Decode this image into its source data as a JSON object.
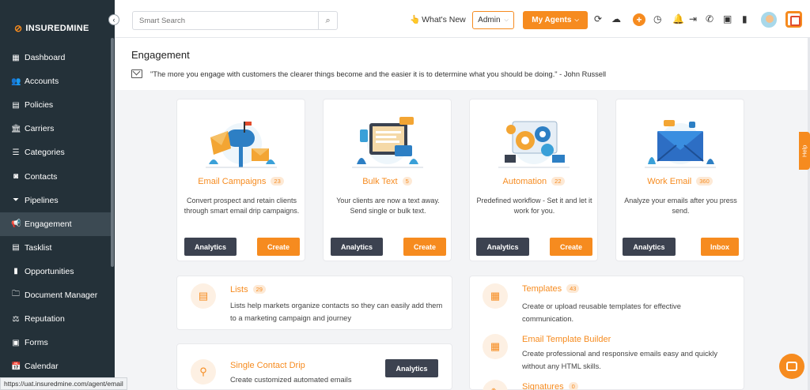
{
  "brand": {
    "name": "INSUREDMINE",
    "accent": "#f68b1f",
    "sidebar_bg": "#243139"
  },
  "sidebar": {
    "items": [
      {
        "label": "Dashboard",
        "icon": "dashboard-icon",
        "glyph": "▦"
      },
      {
        "label": "Accounts",
        "icon": "accounts-icon",
        "glyph": "👥"
      },
      {
        "label": "Policies",
        "icon": "policies-icon",
        "glyph": "▤"
      },
      {
        "label": "Carriers",
        "icon": "carriers-icon",
        "glyph": "🏛"
      },
      {
        "label": "Categories",
        "icon": "categories-icon",
        "glyph": "☰"
      },
      {
        "label": "Contacts",
        "icon": "contacts-icon",
        "glyph": "◙"
      },
      {
        "label": "Pipelines",
        "icon": "pipelines-icon",
        "glyph": "⏷"
      },
      {
        "label": "Engagement",
        "icon": "megaphone-icon",
        "glyph": "📢",
        "active": true
      },
      {
        "label": "Tasklist",
        "icon": "tasklist-icon",
        "glyph": "▤"
      },
      {
        "label": "Opportunities",
        "icon": "opportunities-icon",
        "glyph": "▮"
      },
      {
        "label": "Document Manager",
        "icon": "folder-icon",
        "glyph": "🗀"
      },
      {
        "label": "Reputation",
        "icon": "reputation-icon",
        "glyph": "⚖"
      },
      {
        "label": "Forms",
        "icon": "forms-icon",
        "glyph": "▣"
      },
      {
        "label": "Calendar",
        "icon": "calendar-icon",
        "glyph": "📅"
      }
    ]
  },
  "topbar": {
    "search_placeholder": "Smart Search",
    "whats_new": "What's New",
    "admin": "Admin",
    "my_agents": "My Agents"
  },
  "page": {
    "title": "Engagement",
    "quote": "\"The more you engage with customers the clearer things become and the easier it is to determine what you should be doing.\" - John Russell"
  },
  "cards": [
    {
      "title": "Email Campaigns",
      "count": "23",
      "desc": "Convert prospect and retain clients through smart email drip campaigns.",
      "btn1": "Analytics",
      "btn2": "Create"
    },
    {
      "title": "Bulk Text",
      "count": "5",
      "desc": "Your clients are now a text away. Send single or bulk text.",
      "btn1": "Analytics",
      "btn2": "Create"
    },
    {
      "title": "Automation",
      "count": "22",
      "desc": "Predefined workflow - Set it and let it work for you.",
      "btn1": "Analytics",
      "btn2": "Create"
    },
    {
      "title": "Work Email",
      "count": "360",
      "desc": "Analyze your emails after you press send.",
      "btn1": "Analytics",
      "btn2": "Inbox"
    }
  ],
  "lists": {
    "title": "Lists",
    "count": "29",
    "desc": "Lists help markets organize contacts so they can easily add them to a marketing campaign and journey"
  },
  "templates": {
    "title": "Templates",
    "count": "43",
    "desc": "Create or upload reusable templates for effective communication."
  },
  "template_builder": {
    "title": "Email Template Builder",
    "desc": "Create professional and responsive emails easy and quickly without any HTML skills."
  },
  "signatures": {
    "title": "Signatures",
    "count": "0"
  },
  "single_drip": {
    "title": "Single Contact Drip",
    "desc": "Create customized automated emails",
    "btn": "Analytics"
  },
  "status_url": "https://uat.insuredmine.com/agent/email",
  "help": "Help"
}
